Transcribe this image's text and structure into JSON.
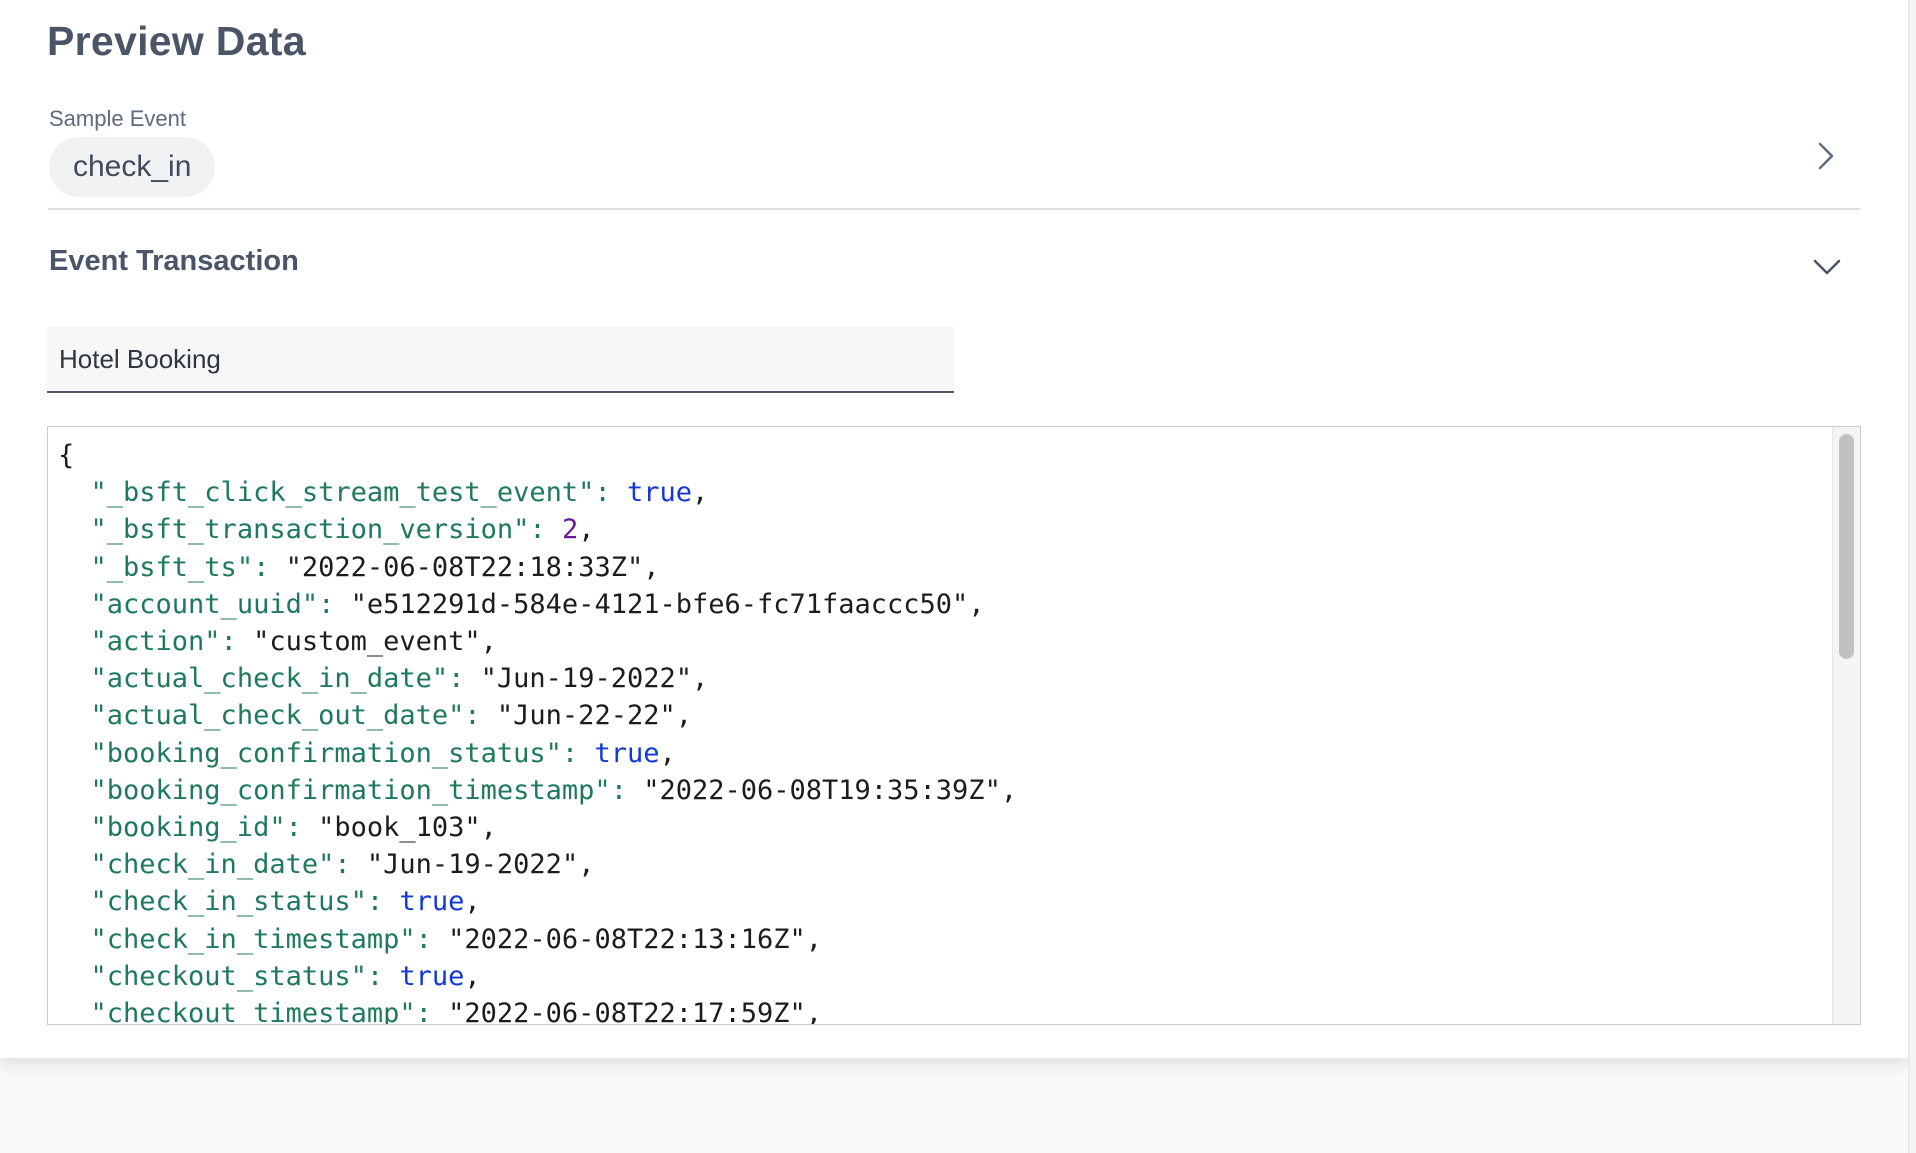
{
  "header": {
    "title": "Preview Data"
  },
  "sample_event": {
    "label": "Sample Event",
    "value": "check_in",
    "chevron_icon": "chevron-right-icon"
  },
  "event_transaction": {
    "title": "Event Transaction",
    "chevron_icon": "chevron-down-icon",
    "input_value": "Hotel Booking"
  },
  "json_preview": {
    "open_brace": "{",
    "lines": [
      {
        "key": "\"_bsft_click_stream_test_event\"",
        "value": "true",
        "type": "bool"
      },
      {
        "key": "\"_bsft_transaction_version\"",
        "value": "2",
        "type": "num"
      },
      {
        "key": "\"_bsft_ts\"",
        "value": "\"2022-06-08T22:18:33Z\"",
        "type": "str"
      },
      {
        "key": "\"account_uuid\"",
        "value": "\"e512291d-584e-4121-bfe6-fc71faaccc50\"",
        "type": "str"
      },
      {
        "key": "\"action\"",
        "value": "\"custom_event\"",
        "type": "str"
      },
      {
        "key": "\"actual_check_in_date\"",
        "value": "\"Jun-19-2022\"",
        "type": "str"
      },
      {
        "key": "\"actual_check_out_date\"",
        "value": "\"Jun-22-22\"",
        "type": "str"
      },
      {
        "key": "\"booking_confirmation_status\"",
        "value": "true",
        "type": "bool"
      },
      {
        "key": "\"booking_confirmation_timestamp\"",
        "value": "\"2022-06-08T19:35:39Z\"",
        "type": "str"
      },
      {
        "key": "\"booking_id\"",
        "value": "\"book_103\"",
        "type": "str"
      },
      {
        "key": "\"check_in_date\"",
        "value": "\"Jun-19-2022\"",
        "type": "str"
      },
      {
        "key": "\"check_in_status\"",
        "value": "true",
        "type": "bool"
      },
      {
        "key": "\"check_in_timestamp\"",
        "value": "\"2022-06-08T22:13:16Z\"",
        "type": "str"
      },
      {
        "key": "\"checkout_status\"",
        "value": "true",
        "type": "bool"
      },
      {
        "key": "\"checkout_timestamp\"",
        "value": "\"2022-06-08T22:17:59Z\"",
        "type": "str"
      }
    ]
  },
  "colors": {
    "key": "#1f7a5a",
    "boolean": "#1238d6",
    "number": "#6a1b9a",
    "string": "#1c1c1c",
    "title": "#4a5668"
  }
}
